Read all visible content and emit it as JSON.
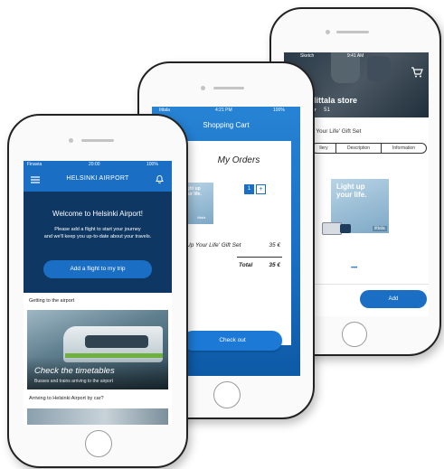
{
  "phone_right": {
    "status": {
      "carrier": "Sketch",
      "time": "9:41 AM",
      "battery": "100%"
    },
    "store_title": "n: Iittala store",
    "rating_count": "51",
    "product_title": "p Your Life' Gift Set",
    "tabs": [
      "llery",
      "Description",
      "Information"
    ],
    "box_text": [
      "Light up",
      "your life."
    ],
    "brand_tag": "iittala",
    "add_label": "Add"
  },
  "phone_middle": {
    "status": {
      "carrier": "Iittala",
      "time": "4:21 PM",
      "battery": "100%"
    },
    "header_title": "Shopping Cart",
    "orders_title": "My Orders",
    "quantity": "1",
    "plus_label": "+",
    "box_text": [
      "Light up",
      "your life."
    ],
    "brand_tag": "iittala",
    "item_name": "Up Your Life' Gift Set",
    "item_price": "35 €",
    "total_label": "Total",
    "total_price": "35 €",
    "checkout_label": "Check out"
  },
  "phone_left": {
    "status": {
      "carrier": "Finavia",
      "time": "20:00",
      "battery": "100%"
    },
    "app_title": "HELSINKI AIRPORT",
    "welcome_title": "Welcome to Helsinki Airport!",
    "welcome_body": [
      "Please add a flight to start your journey",
      "and we'll keep you up-to-date about your travels."
    ],
    "add_flight_label": "Add a flight to my trip",
    "section_getting": "Getting to the airport",
    "card_title": "Check the timetables",
    "card_sub": "Busses and trains arriving to the airport",
    "section_car": "Arriving to Helsinki Airport by car?"
  },
  "colors": {
    "primary_blue": "#1a6fc4",
    "navy": "#0e3763",
    "phone_frame": "#222222"
  }
}
